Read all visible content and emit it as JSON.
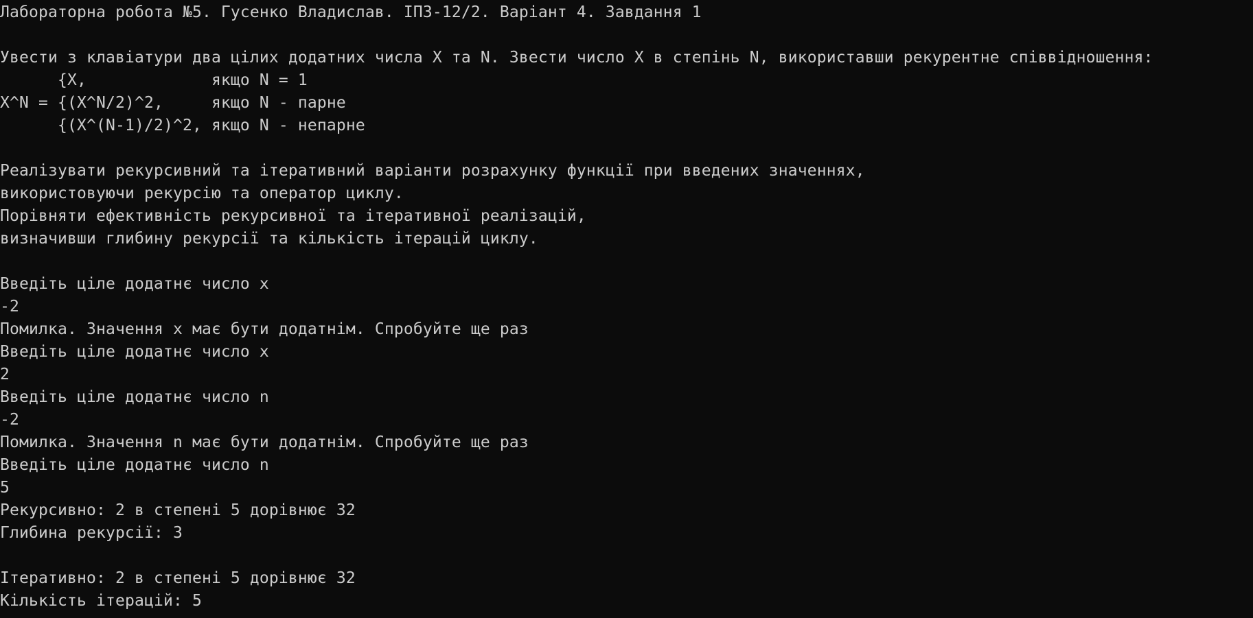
{
  "console": {
    "lines": [
      "Лабораторна робота №5. Гусенко Владислав. ІПЗ-12/2. Варіант 4. Завдання 1",
      "",
      "Увести з клавіатури два цілих додатних числа X та N. Звести число X в степінь N, використавши рекурентне співвідношення:",
      "      {X,             якщо N = 1",
      "X^N = {(X^N/2)^2,     якщо N - парне",
      "      {(X^(N-1)/2)^2, якщо N - непарне",
      "",
      "Реалізувати рекурсивний та ітеративний варіанти розрахунку функції при введених значеннях,",
      "використовуючи рекурсію та оператор циклу.",
      "Порівняти ефективність рекурсивної та ітеративної реалізацій,",
      "визначивши глибину рекурсії та кількість ітерацій циклу.",
      "",
      "Введіть ціле додатнє число x",
      "-2",
      "Помилка. Значення x має бути додатнім. Спробуйте ще раз",
      "Введіть ціле додатнє число x",
      "2",
      "Введіть ціле додатнє число n",
      "-2",
      "Помилка. Значення n має бути додатнім. Спробуйте ще раз",
      "Введіть ціле додатнє число n",
      "5",
      "Рекурсивно: 2 в степені 5 дорівнює 32",
      "Глибина рекурсії: 3",
      "",
      "Ітеративно: 2 в степені 5 дорівнює 32",
      "Кількість ітерацій: 5"
    ]
  }
}
